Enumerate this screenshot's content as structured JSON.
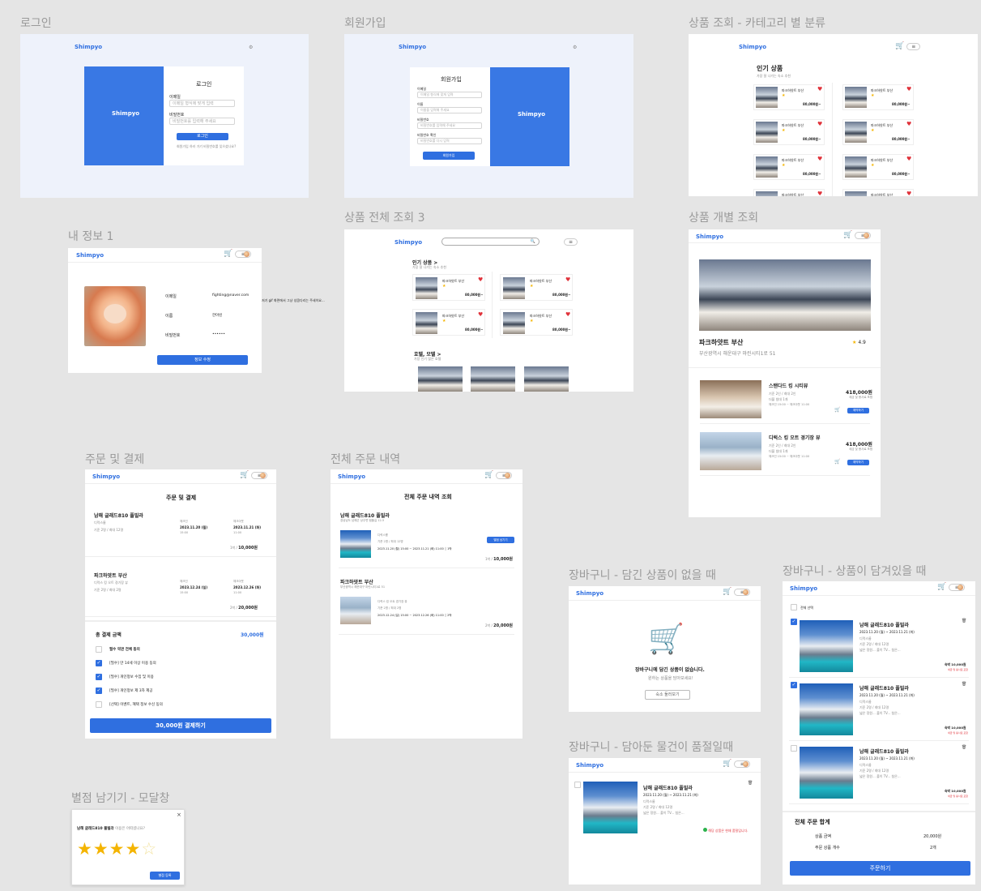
{
  "labels": {
    "login": "로그인",
    "signup": "회원가입",
    "category": "상품 조회 - 카테고리 별 분류",
    "myinfo": "내 정보 1",
    "all_products": "상품 전체 조회 3",
    "product_detail": "상품 개별 조회",
    "order": "주문 및 결제",
    "order_history": "전체 주문 내역",
    "cart_empty": "장바구니 - 담긴 상품이 없을 때",
    "cart_items": "장바구니 - 상품이 담겨있을 때",
    "cart_soldout": "장바구니 - 담아둔 물건이 품절일때",
    "rating": "별점 남기기 - 모달창"
  },
  "brand": "Shimpyo",
  "login": {
    "title": "로그인",
    "email_label": "이메일",
    "email_ph": "이메일 형식에 맞게 입력",
    "pw_label": "비밀번호",
    "pw_ph": "비밀번호를 입력해 주세요",
    "submit": "로그인",
    "link1": "회원가입 하러 가기",
    "link2": "비밀번호를 잊으셨나요?",
    "gear": "⚙"
  },
  "signup": {
    "title": "회원가입",
    "f1": "이메일",
    "f2": "이름",
    "f3": "비밀번호",
    "f4": "비밀번호 확인",
    "ph1": "이메일 형식에 맞게 입력",
    "ph2": "이름을 입력해 주세요",
    "ph3": "비밀번호를 입력해 주세요",
    "ph4": "비밀번호를 다시 입력",
    "submit": "회원가입",
    "gear": "⚙"
  },
  "category": {
    "title": "인기 상품",
    "subtitle": "가장 잘 나가는 숙소 추천",
    "items": [
      {
        "name": "파크하얏트 부산",
        "price": "80,000원~"
      },
      {
        "name": "파크하얏트 부산",
        "price": "80,000원~"
      },
      {
        "name": "파크하얏트 부산",
        "price": "80,000원~"
      },
      {
        "name": "파크하얏트 부산",
        "price": "80,000원~"
      },
      {
        "name": "파크하얏트 부산",
        "price": "80,000원~"
      },
      {
        "name": "파크하얏트 부산",
        "price": "80,000원~"
      },
      {
        "name": "파크하얏트 부산",
        "price": "80,000원~"
      },
      {
        "name": "파크하얏트 부산",
        "price": "80,000원~"
      }
    ]
  },
  "myinfo": {
    "rows": [
      {
        "k": "이메일",
        "v": "fighting@naver.com"
      },
      {
        "k": "이름",
        "v": "한아린"
      },
      {
        "k": "비밀번호",
        "v": "••••••"
      }
    ],
    "edit": "정보 수정",
    "side_note": "저기 gif 화면에서 그냥 성큼다리는 주세이요..."
  },
  "all": {
    "search_ph": "",
    "sec1": "인기 상품 >",
    "sec1_sub": "가장 잘 나가는 숙소 추천",
    "sec2": "호텔, 모텔 >",
    "sec2_sub": "가장 인기 많은 호텔",
    "items": [
      {
        "name": "파크하얏트 부산",
        "price": "80,000원~"
      },
      {
        "name": "파크하얏트 부산",
        "price": "80,000원~"
      },
      {
        "name": "파크하얏트 부산",
        "price": "80,000원~"
      },
      {
        "name": "파크하얏트 부산",
        "price": "80,000원~"
      }
    ]
  },
  "detail": {
    "name": "파크하얏트 부산",
    "address": "부산광역시 해운대구 마린시티1로 51",
    "rating": "4.9",
    "rooms": [
      {
        "name": "스탠다드 킹 시티뷰",
        "l1": "기준 2인 / 최대 2인",
        "l2": "더블 침대 1개",
        "l3": "체크인 15:00 ~ 체크아웃 11:00",
        "price": "418,000원",
        "note": "세금 및 봉사료 포함",
        "btn": "예약하기"
      },
      {
        "name": "디럭스 킹 오트 경기장 뷰",
        "l1": "기준 2인 / 최대 2인",
        "l2": "더블 침대 1개",
        "l3": "체크인 15:00 ~ 체크아웃 11:00",
        "price": "418,000원",
        "note": "세금 및 봉사료 포함",
        "btn": "예약하기"
      }
    ]
  },
  "order": {
    "title": "주문 및 결제",
    "items": [
      {
        "name": "남해 글래드810 풀빌라",
        "l1": "디럭스룸",
        "l2": "기준 2명 / 최대 12명",
        "in_label": "체크인",
        "in_date": "2023.11.20 (월)",
        "in_time": "15:00",
        "out_label": "체크아웃",
        "out_date": "2023.11.21 (화)",
        "out_time": "11:00",
        "price_line": "1박 /",
        "price": "10,000원"
      },
      {
        "name": "파크하얏트 부산",
        "l1": "디럭스 킹 오트 경기장 뷰",
        "l2": "기준 2명 / 최대 2명",
        "in_label": "체크인",
        "in_date": "2023.12.24 (일)",
        "in_time": "15:00",
        "out_label": "체크아웃",
        "out_date": "2023.12.26 (화)",
        "out_time": "11:00",
        "price_line": "2박 /",
        "price": "20,000원"
      }
    ],
    "total_label": "총 결제 금액",
    "total": "30,000원",
    "agrees": [
      {
        "t": "필수 약관 전체 동의",
        "on": false,
        "bold": true
      },
      {
        "t": "[필수] 만 14세 이상 이용 동의",
        "on": true
      },
      {
        "t": "[필수] 개인정보 수집 및 이용",
        "on": true
      },
      {
        "t": "[필수] 개인정보 제 3자 제공",
        "on": true
      },
      {
        "t": "[선택] 이벤트, 혜택 정보 수신 동의",
        "on": false
      }
    ],
    "pay": "30,000원 결제하기"
  },
  "history": {
    "title": "전체 주문 내역 조회",
    "items": [
      {
        "name": "남해 글래드810 풀빌라",
        "addr": "경상남도 남해군 상주면 템플길 12-5",
        "room": "디럭스룸",
        "cap": "기준 2명 / 최대 12명",
        "date": "2023.11.20 (월) 15:00 ~ 2023.11.21 (화) 11:00 │ 1박",
        "price_line": "1박 /",
        "price": "10,000원",
        "btn": "별점 남기기"
      },
      {
        "name": "파크하얏트 부산",
        "addr": "부산광역시 해운대구 마린시티1로 51",
        "room": "디럭스 킹 오트 경기장 뷰",
        "cap": "기준 2명 / 최대 2명",
        "date": "2023.12.24 (일) 15:00 ~ 2023.12.26 (화) 11:00 │ 2박",
        "price_line": "2박 /",
        "price": "20,000원"
      }
    ]
  },
  "cart_empty": {
    "msg": "장바구니에 담긴 상품이 없습니다.",
    "sub": "원하는 상품을 담아보세요!",
    "btn": "숙소 둘러보기"
  },
  "cart": {
    "all": "전체 선택",
    "items": [
      {
        "name": "남해 글래드810 풀빌라",
        "date": "2023.11.20 (월) ~ 2023.11.21 (화)",
        "room": "디럭스룸",
        "cap": "기준 2명 / 최대 12명",
        "desc": "넓은 정원... 풀이 TV... 침은...",
        "price": "숙박 10,000원",
        "note": "세금 및 봉사료 포함",
        "on": true
      },
      {
        "name": "남해 글래드810 풀빌라",
        "date": "2023.11.20 (월) ~ 2023.11.21 (화)",
        "room": "디럭스룸",
        "cap": "기준 2명 / 최대 12명",
        "desc": "넓은 정원... 풀이 TV... 침은...",
        "price": "숙박 10,000원",
        "note": "세금 및 봉사료 포함",
        "on": true
      },
      {
        "name": "남해 글래드810 풀빌라",
        "date": "2023.11.20 (월) ~ 2023.11.21 (화)",
        "room": "디럭스룸",
        "cap": "기준 2명 / 최대 12명",
        "desc": "넓은 정원... 풀이 TV... 침은...",
        "price": "숙박 10,000원",
        "note": "세금 및 봉사료 포함",
        "on": false
      }
    ],
    "sum_title": "전체 주문 합계",
    "sum_k1": "상품 금액",
    "sum_v1": "20,000원",
    "sum_k2": "주문 상품 개수",
    "sum_v2": "2개",
    "order_btn": "주문하기"
  },
  "soldout": {
    "name": "남해 글래드810 풀빌라",
    "date": "2023.11.20 (월) ~ 2023.11.21 (화)",
    "room": "디럭스룸",
    "cap": "기준 2명 / 최대 12명",
    "desc": "넓은 정원... 풀이 TV... 침은...",
    "warn": "해당 상품은 현재 품절입니다."
  },
  "rating": {
    "q_bold": "남해 글래드810 풀빌라",
    "q_rest": "이용은 어떠셨나요?",
    "btn": "별점 등록",
    "stars": 4,
    "close": "×"
  },
  "colors": {
    "primary": "#2f6fe0",
    "heart": "#e0323a",
    "star": "#f4b400"
  }
}
